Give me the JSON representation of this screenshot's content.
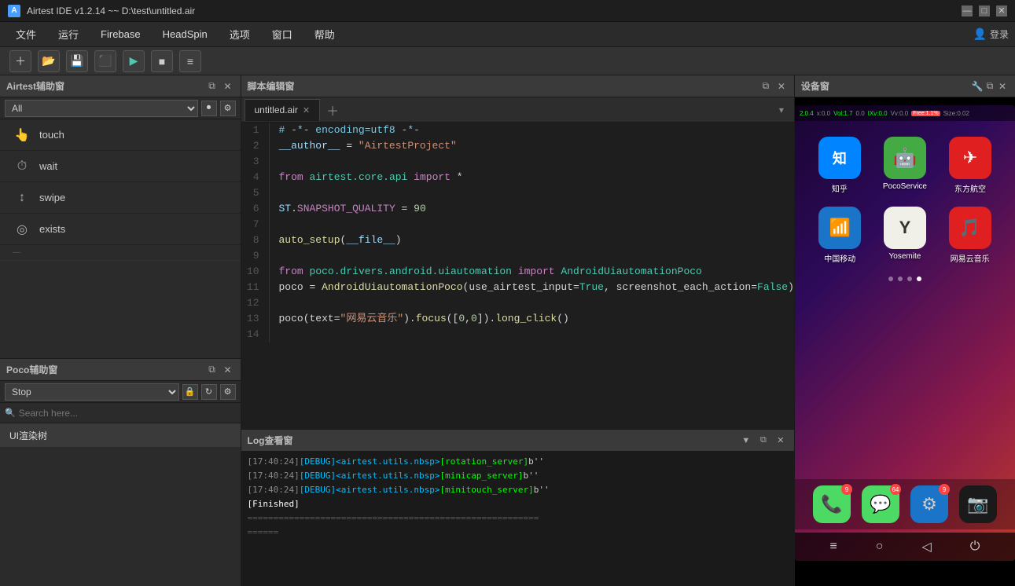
{
  "app": {
    "title": "Airtest IDE v1.2.14 ~~ D:\\test\\untitled.air",
    "icon": "A"
  },
  "titlebar": {
    "minimize": "—",
    "maximize": "□",
    "close": "✕"
  },
  "menu": {
    "items": [
      "文件",
      "运行",
      "Firebase",
      "HeadSpin",
      "选项",
      "窗口",
      "帮助"
    ]
  },
  "toolbar": {
    "buttons": [
      "＋",
      "📁",
      "💾",
      "⬛",
      "▶",
      "■",
      "≡"
    ]
  },
  "airtest_panel": {
    "title": "Airtest辅助窗",
    "filter_placeholder": "All",
    "items": [
      {
        "icon": "👆",
        "label": "touch"
      },
      {
        "icon": "⏱",
        "label": "wait"
      },
      {
        "icon": "👆",
        "label": "swipe"
      },
      {
        "icon": "◎",
        "label": "exists"
      }
    ]
  },
  "poco_panel": {
    "title": "Poco辅助窗",
    "stop_label": "Stop",
    "search_placeholder": "Search here...",
    "tree_item": "UI渲染树"
  },
  "script_editor": {
    "title": "脚本编辑窗",
    "tab_name": "untitled.air",
    "code_lines": [
      {
        "num": 1,
        "content": "# -*- encoding=utf8 -*-"
      },
      {
        "num": 2,
        "content": "__author__ = \"AirtestProject\""
      },
      {
        "num": 3,
        "content": ""
      },
      {
        "num": 4,
        "content": "from airtest.core.api import *"
      },
      {
        "num": 5,
        "content": ""
      },
      {
        "num": 6,
        "content": "ST.SNAPSHOT_QUALITY = 90"
      },
      {
        "num": 7,
        "content": ""
      },
      {
        "num": 8,
        "content": "auto_setup(__file__)"
      },
      {
        "num": 9,
        "content": ""
      },
      {
        "num": 10,
        "content": "from poco.drivers.android.uiautomation import AndroidUiautomationPoco"
      },
      {
        "num": 11,
        "content": "poco = AndroidUiautomationPoco(use_airtest_input=True, screenshot_each_action=False)"
      },
      {
        "num": 12,
        "content": ""
      },
      {
        "num": 13,
        "content": "poco(text=\"网易云音乐\").focus([0,0]).long_click()"
      },
      {
        "num": 14,
        "content": ""
      }
    ]
  },
  "log_panel": {
    "title": "Log查看窗",
    "lines": [
      "[17:40:24][DEBUG]<airtest.utils.nbsp>[rotation_server]b''",
      "[17:40:24][DEBUG]<airtest.utils.nbsp>[minicap_server]b''",
      "[17:40:24][DEBUG]<airtest.utils.nbsp>[minitouch_server]b''",
      "[Finished]",
      "",
      "========================================================"
    ]
  },
  "device_panel": {
    "title": "设备窗",
    "status_bar": {
      "items": [
        "2.0.4",
        "x:0.0",
        "Vol:1.7",
        "0.0",
        "IXv:0.0",
        "Vv:0.0",
        "Free:1.1%",
        "Size:0.02"
      ]
    },
    "apps_row1": [
      {
        "name": "知乎",
        "bg": "#0084ff",
        "text": "知",
        "badge": ""
      },
      {
        "name": "PocoService",
        "bg": "#78c257",
        "text": "🤖",
        "badge": ""
      },
      {
        "name": "东方航空",
        "bg": "#e02020",
        "text": "✈",
        "badge": ""
      }
    ],
    "apps_row2": [
      {
        "name": "中国移动",
        "bg": "#1a75c9",
        "text": "📱",
        "badge": ""
      },
      {
        "name": "Yosemite",
        "bg": "#f0f0e8",
        "text": "Y",
        "badge": ""
      },
      {
        "name": "网易云音乐",
        "bg": "#e02020",
        "text": "🎵",
        "badge": ""
      }
    ],
    "dock_apps": [
      {
        "name": "Phone",
        "bg": "#4cd964",
        "text": "📞",
        "badge": "9"
      },
      {
        "name": "Messages",
        "bg": "#4cd964",
        "text": "💬",
        "badge": "64"
      },
      {
        "name": "Settings",
        "bg": "#1a75c9",
        "text": "⚙",
        "badge": "9"
      },
      {
        "name": "Camera",
        "bg": "#1a1a1a",
        "text": "📷",
        "badge": ""
      }
    ],
    "nav": [
      "≡",
      "○",
      "◁"
    ]
  },
  "login": {
    "label": "登录"
  }
}
